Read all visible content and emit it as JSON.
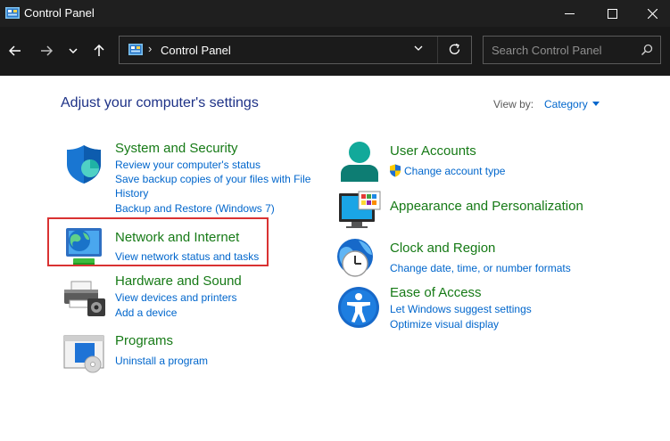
{
  "window": {
    "title": "Control Panel"
  },
  "nav": {
    "address_path": "Control Panel",
    "search_placeholder": "Search Control Panel"
  },
  "main": {
    "heading": "Adjust your computer's settings",
    "view_by_label": "View by:",
    "view_by_value": "Category"
  },
  "categories": {
    "system_security": {
      "title": "System and Security",
      "links": [
        "Review your computer's status",
        "Save backup copies of your files with File",
        "History",
        "Backup and Restore (Windows 7)"
      ]
    },
    "network_internet": {
      "title": "Network and Internet",
      "links": [
        "View network status and tasks"
      ]
    },
    "hardware_sound": {
      "title": "Hardware and Sound",
      "links": [
        "View devices and printers",
        "Add a device"
      ]
    },
    "programs": {
      "title": "Programs",
      "links": [
        "Uninstall a program"
      ]
    },
    "user_accounts": {
      "title": "User Accounts",
      "links": [
        "Change account type"
      ]
    },
    "appearance": {
      "title": "Appearance and Personalization"
    },
    "clock_region": {
      "title": "Clock and Region",
      "links": [
        "Change date, time, or number formats"
      ]
    },
    "ease_access": {
      "title": "Ease of Access",
      "links": [
        "Let Windows suggest settings",
        "Optimize visual display"
      ]
    }
  },
  "colors": {
    "heading": "#1e3287",
    "category_title": "#167a16",
    "link": "#0066cc",
    "highlight": "#d93232",
    "titlebar": "#1f1f1f"
  },
  "icons": [
    "control-panel-icon",
    "back-arrow-icon",
    "forward-arrow-icon",
    "chevron-down-icon",
    "up-arrow-icon",
    "refresh-icon",
    "search-icon",
    "minimize-icon",
    "maximize-icon",
    "close-icon",
    "shield-icon",
    "globe-network-icon",
    "printer-icon",
    "programs-icon",
    "user-icon",
    "appearance-icon",
    "clock-icon",
    "accessibility-icon",
    "uac-shield-icon"
  ]
}
